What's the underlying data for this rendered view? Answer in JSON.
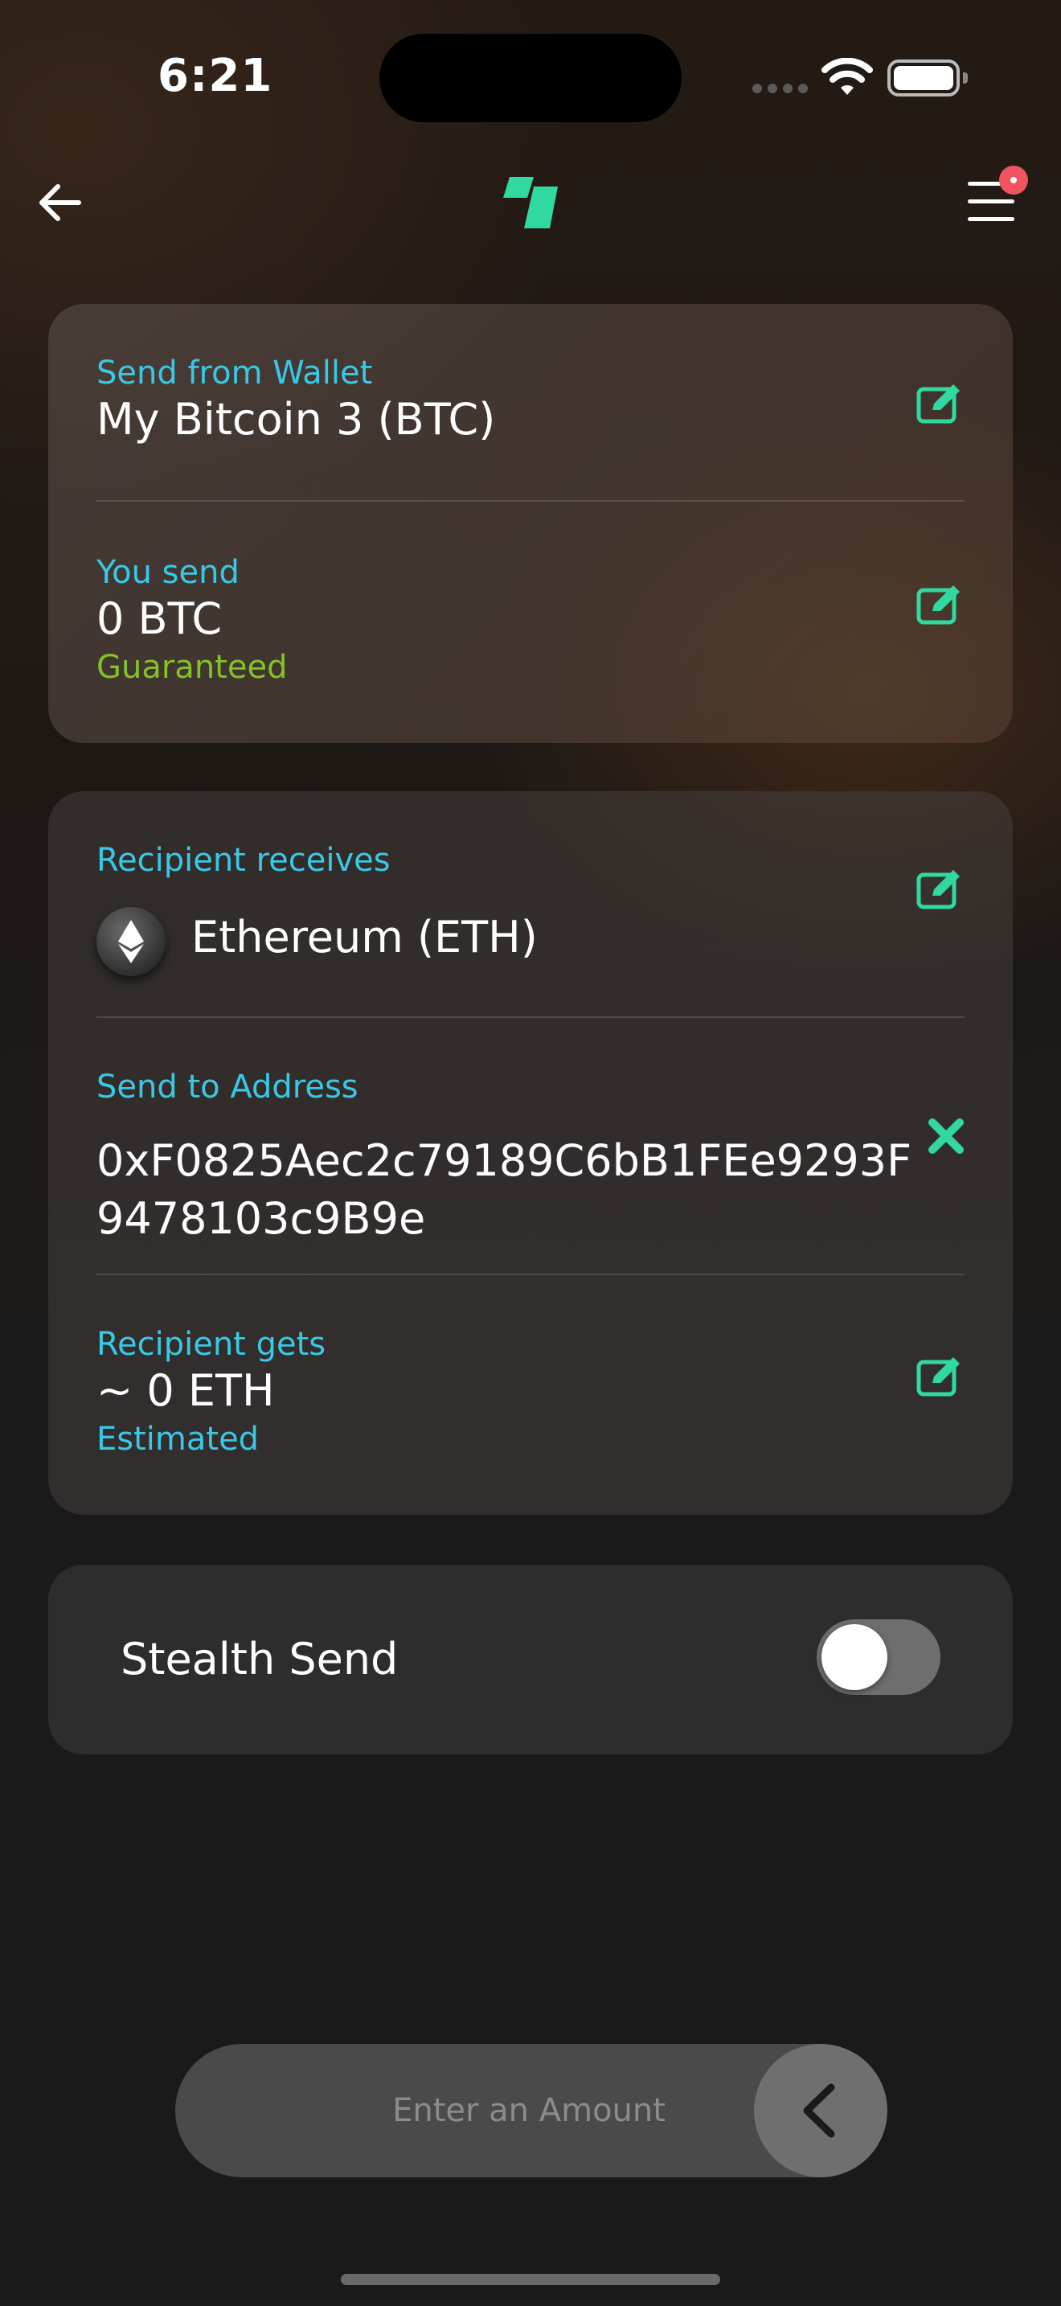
{
  "status_bar": {
    "time": "6:21"
  },
  "wallet_card": {
    "from_label": "Send from Wallet",
    "from_value": "My Bitcoin 3 (BTC)",
    "send_label": "You send",
    "send_value": "0 BTC",
    "send_note": "Guaranteed"
  },
  "recipient_card": {
    "receives_label": "Recipient receives",
    "receives_value": "Ethereum (ETH)",
    "address_label": "Send to Address",
    "address_value": "0xF0825Aec2c79189C6bB1FEe9293F9478103c9B9e",
    "gets_label": "Recipient gets",
    "gets_value": "~ 0 ETH",
    "gets_note": "Estimated"
  },
  "stealth": {
    "label": "Stealth Send",
    "enabled": false
  },
  "amount_slider": {
    "placeholder": "Enter an Amount"
  },
  "colors": {
    "accent_green": "#2fd9a0",
    "label_cyan": "#39c8e6",
    "guaranteed_green": "#84c225",
    "notification_red": "#f0555f"
  },
  "icons": [
    "back-arrow-icon",
    "app-logo",
    "menu-icon",
    "edit-icon",
    "clear-icon",
    "ethereum-icon",
    "chevron-left-icon"
  ]
}
